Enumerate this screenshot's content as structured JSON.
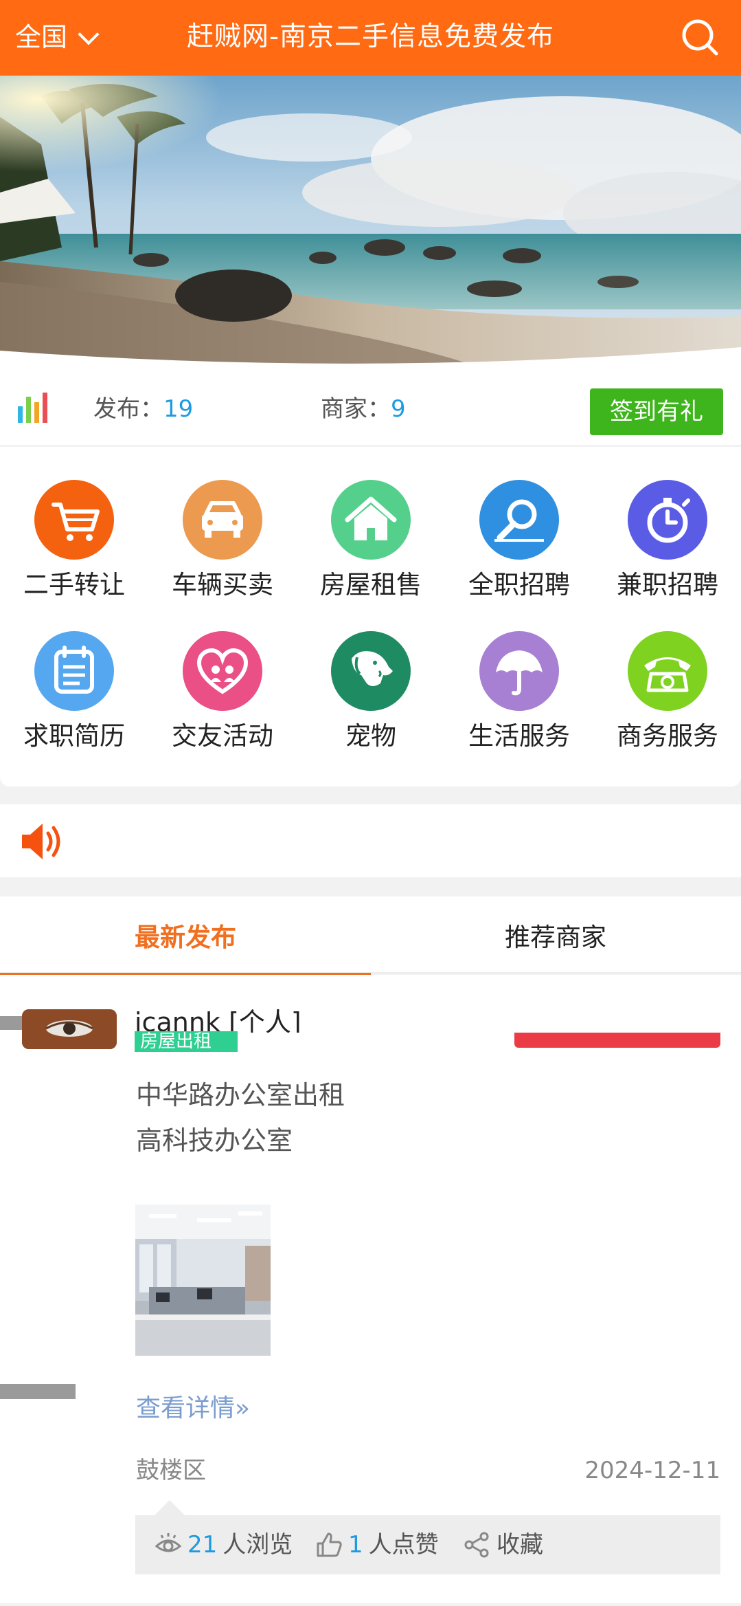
{
  "header": {
    "city": "全国",
    "title": "赶贼网-南京二手信息免费发布"
  },
  "stats": {
    "posts_label": "发布：",
    "posts_value": "19",
    "merchants_label": "商家：",
    "merchants_value": "9",
    "checkin_label": "签到有礼"
  },
  "categories": [
    {
      "label": "二手转让",
      "icon": "cart-icon",
      "color": "#f5620f"
    },
    {
      "label": "车辆买卖",
      "icon": "car-icon",
      "color": "#ec9a4f"
    },
    {
      "label": "房屋租售",
      "icon": "house-icon",
      "color": "#54d08c"
    },
    {
      "label": "全职招聘",
      "icon": "magnifier-icon",
      "color": "#2f8fe0"
    },
    {
      "label": "兼职招聘",
      "icon": "stopwatch-icon",
      "color": "#5a5ce6"
    },
    {
      "label": "求职简历",
      "icon": "notepad-icon",
      "color": "#55a7ef"
    },
    {
      "label": "交友活动",
      "icon": "heart-icon",
      "color": "#ea4f85"
    },
    {
      "label": "宠物",
      "icon": "dog-icon",
      "color": "#1e8b63"
    },
    {
      "label": "生活服务",
      "icon": "umbrella-icon",
      "color": "#a780d3"
    },
    {
      "label": "商务服务",
      "icon": "telephone-icon",
      "color": "#7fd220"
    }
  ],
  "tabs": [
    {
      "label": "最新发布",
      "active": true
    },
    {
      "label": "推荐商家",
      "active": false
    }
  ],
  "post": {
    "username": "icannk [个人]",
    "tag": "房屋出租",
    "line1": "中华路办公室出租",
    "line2": "高科技办公室",
    "detail_link": "查看详情»",
    "district": "鼓楼区",
    "date": "2024-12-11",
    "views_value": "21",
    "views_label": "人浏览",
    "likes_value": "1",
    "likes_label": "人点赞",
    "favorite_label": "收藏"
  }
}
